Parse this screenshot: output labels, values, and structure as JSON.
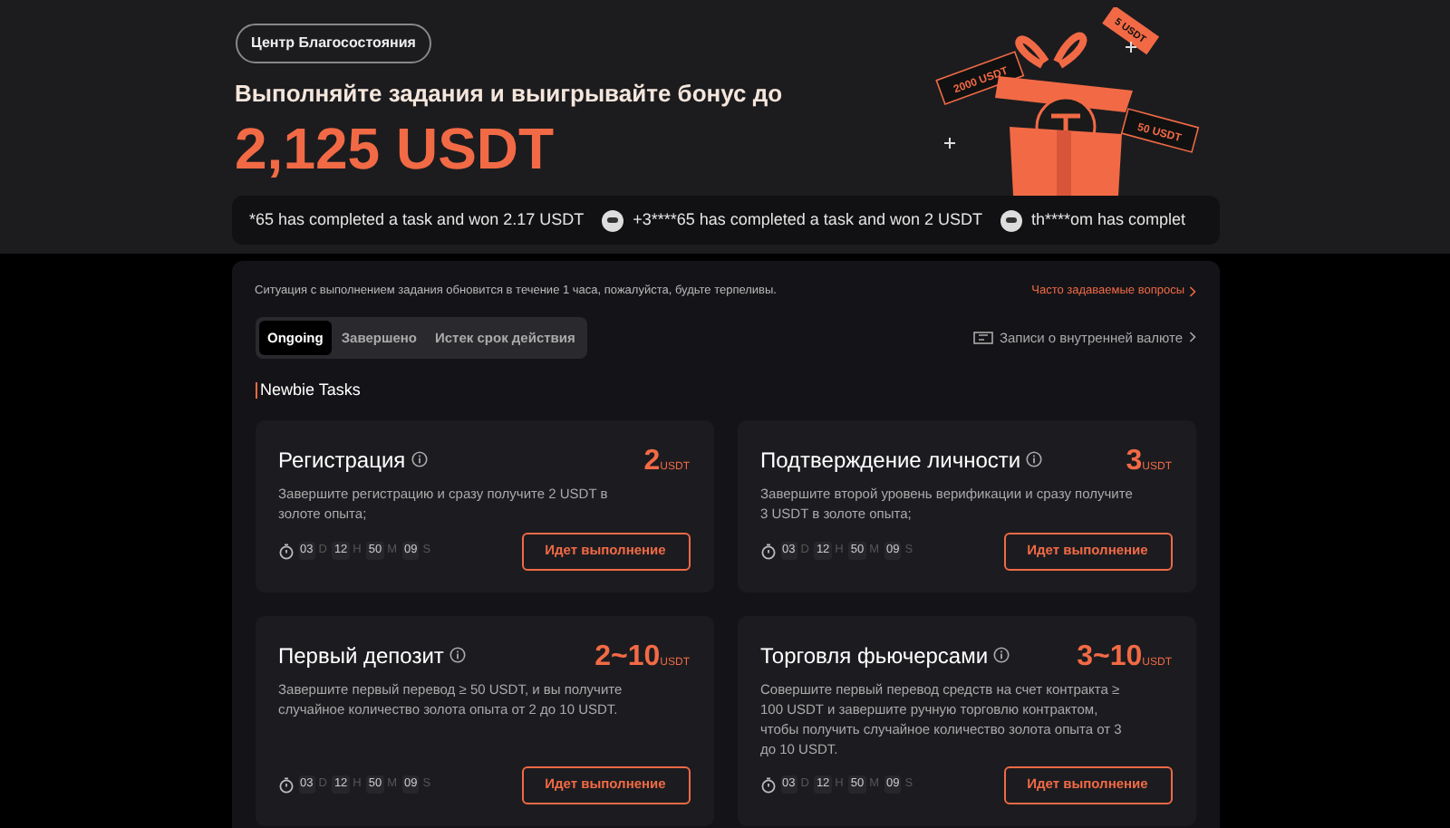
{
  "hero": {
    "badge": "Центр Благосостояния",
    "headline": "Выполняйте задания и выигрывайте бонус до",
    "amount": "2,125 USDT",
    "gift_tags": [
      "2000 USDT",
      "5 USDT",
      "50 USDT"
    ]
  },
  "ticker": [
    {
      "text": "*65 has completed a task and won 2.17 USDT",
      "avatar": false
    },
    {
      "text": "+3****65 has completed a task and won 2 USDT",
      "avatar": true
    },
    {
      "text": "th****om has complet",
      "avatar": true
    }
  ],
  "notice": "Ситуация с выполнением задания обновится в течение 1 часа, пожалуйста, будьте терпеливы.",
  "faq_link": "Часто задаваемые вопросы",
  "tabs": [
    {
      "label": "Ongoing",
      "selected": true
    },
    {
      "label": "Завершено",
      "selected": false
    },
    {
      "label": "Истек срок действия",
      "selected": false
    }
  ],
  "records_link": "Записи о внутренней валюте",
  "section_title": "Newbie Tasks",
  "tasks": [
    {
      "title": "Регистрация",
      "reward": "2",
      "unit": "USDT",
      "description": "Завершите регистрацию и сразу получите 2 USDT в золоте опыта;",
      "timer": [
        {
          "value": "03",
          "unit": "D"
        },
        {
          "value": "12",
          "unit": "H"
        },
        {
          "value": "50",
          "unit": "M"
        },
        {
          "value": "09",
          "unit": "S"
        }
      ],
      "button": "Идет выполнение"
    },
    {
      "title": "Подтверждение личности",
      "reward": "3",
      "unit": "USDT",
      "description": "Завершите второй уровень верификации и сразу получите 3 USDT в золоте опыта;",
      "timer": [
        {
          "value": "03",
          "unit": "D"
        },
        {
          "value": "12",
          "unit": "H"
        },
        {
          "value": "50",
          "unit": "M"
        },
        {
          "value": "09",
          "unit": "S"
        }
      ],
      "button": "Идет выполнение"
    },
    {
      "title": "Первый депозит",
      "reward": "2~10",
      "unit": "USDT",
      "description": "Завершите первый перевод ≥ 50 USDT, и вы получите случайное количество золота опыта от 2 до 10 USDT.",
      "timer": [
        {
          "value": "03",
          "unit": "D"
        },
        {
          "value": "12",
          "unit": "H"
        },
        {
          "value": "50",
          "unit": "M"
        },
        {
          "value": "09",
          "unit": "S"
        }
      ],
      "button": "Идет выполнение"
    },
    {
      "title": "Торговля фьючерсами",
      "reward": "3~10",
      "unit": "USDT",
      "description": "Совершите первый перевод средств на счет контракта ≥ 100 USDT и завершите ручную торговлю контрактом, чтобы получить случайное количество золота опыта от 3 до 10 USDT.",
      "timer": [
        {
          "value": "03",
          "unit": "D"
        },
        {
          "value": "12",
          "unit": "H"
        },
        {
          "value": "50",
          "unit": "M"
        },
        {
          "value": "09",
          "unit": "S"
        }
      ],
      "button": "Идет выполнение"
    }
  ]
}
